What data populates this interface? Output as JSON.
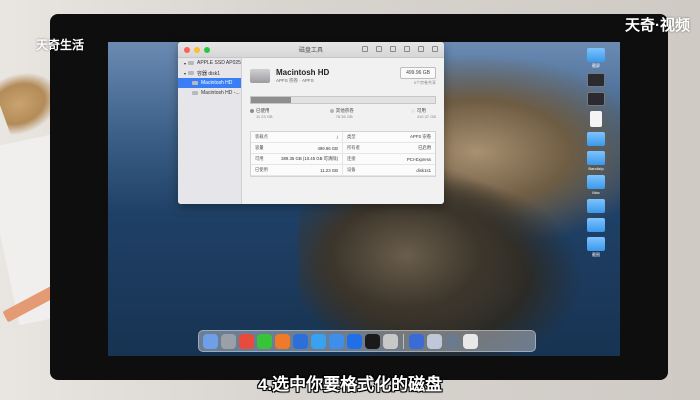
{
  "watermark": {
    "left": "天奇生活",
    "right": "天奇·视频"
  },
  "caption": "4.选中你要格式化的磁盘",
  "window": {
    "title": "磁盘工具",
    "sidebar": [
      {
        "label": "APPLE SSD AP0256...",
        "level": 1,
        "selected": false
      },
      {
        "label": "容器 disk1",
        "level": 1,
        "selected": false
      },
      {
        "label": "Macintosh HD",
        "level": 2,
        "selected": true
      },
      {
        "label": "Macintosh HD -...",
        "level": 2,
        "selected": false
      }
    ],
    "disk_name": "Macintosh HD",
    "disk_sub": "APFS 宗卷 · APFS",
    "capacity": "499.96 GB",
    "capacity_sub": "5个宗卷共享",
    "usage_fraction": 0.22,
    "legend": [
      {
        "label": "已使用",
        "value": "11.23 GB",
        "color": "#8e8e8e"
      },
      {
        "label": "其他宗卷",
        "value": "78.36 GB",
        "color": "#b5b5b5"
      },
      {
        "label": "可用",
        "value": "410.37 GB",
        "color": "#e6e6e6"
      }
    ],
    "info": [
      {
        "k": "装载点",
        "v": "/"
      },
      {
        "k": "类型",
        "v": "APFS 宗卷"
      },
      {
        "k": "容量",
        "v": "499.96 GB"
      },
      {
        "k": "所有者",
        "v": "已启用"
      },
      {
        "k": "可用",
        "v": "389.35 GB (10.45 GB 可清除)"
      },
      {
        "k": "连接",
        "v": "PCI-Express"
      },
      {
        "k": "已使用",
        "v": "11.23 GB"
      },
      {
        "k": "设备",
        "v": "disk1s1"
      }
    ]
  },
  "desktop_icons": [
    "截屏",
    "",
    "",
    "",
    "",
    "Bandizip",
    "Mac",
    "",
    "",
    "截图"
  ],
  "dock_colors": [
    "#6f9fe6",
    "#9aa0a7",
    "#e64b3b",
    "#37c43a",
    "#f07a2a",
    "#2b6fd8",
    "#3aa0f0",
    "#3e8fea",
    "#1f6fe8",
    "#1a1a1a",
    "#c8c8c8",
    "#3a6bd6",
    "#bfc8d8",
    "#6b7a8c",
    "#e8e8e8"
  ]
}
